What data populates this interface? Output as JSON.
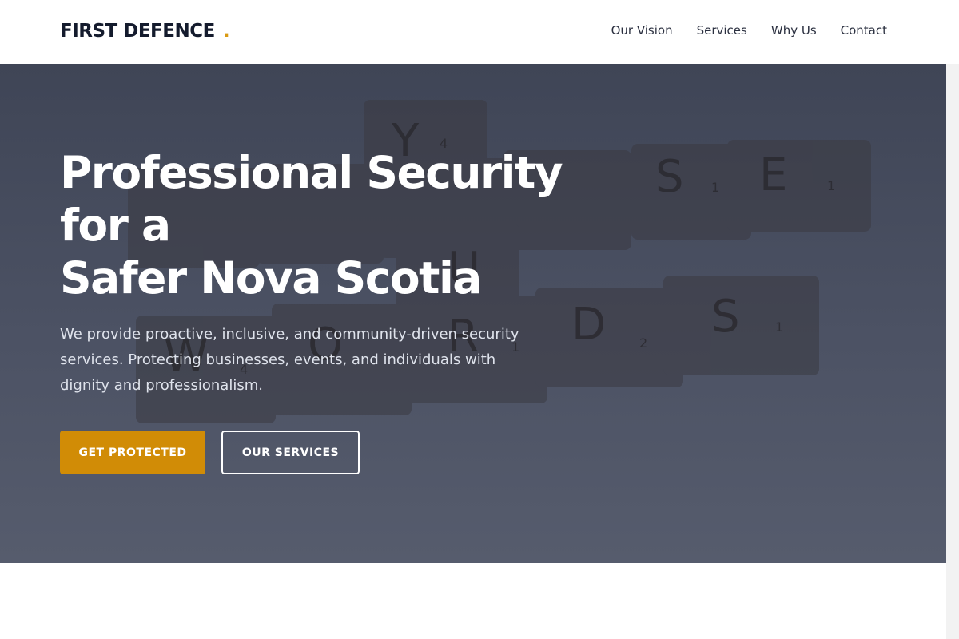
{
  "brand": {
    "name": "FIRST DEFENCE",
    "dot": ".",
    "accent_color": "#d99a12"
  },
  "nav": {
    "items": [
      {
        "label": "Our Vision"
      },
      {
        "label": "Services"
      },
      {
        "label": "Why Us"
      },
      {
        "label": "Contact"
      }
    ]
  },
  "hero": {
    "title_line1": "Professional Security for a",
    "title_line2": "Safer Nova Scotia",
    "subtitle": "We provide proactive, inclusive, and community-driven security services. Protecting businesses, events, and individuals with dignity and professionalism.",
    "primary_button": "GET PROTECTED",
    "secondary_button": "OUR SERVICES",
    "background_image": "scrabble tiles spelling CHOOSE YOUR WORDS"
  },
  "colors": {
    "primary_button": "#d18c06",
    "hero_overlay": "#4a5062"
  }
}
